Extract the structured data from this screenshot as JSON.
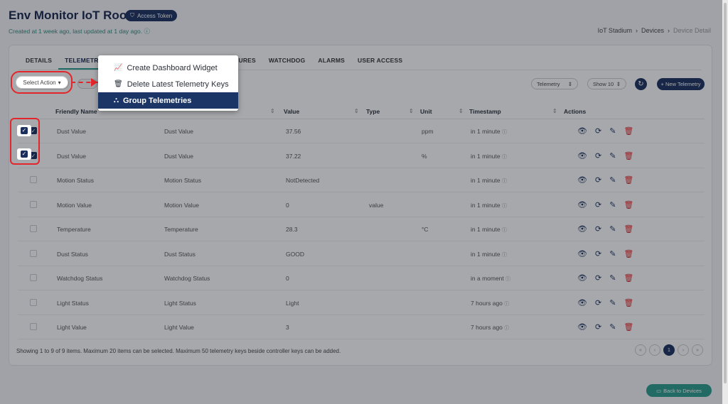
{
  "header": {
    "title": "Env Monitor IoT Room",
    "token_badge": "Access Token",
    "meta": "Created at 1 week ago, last updated at 1 day ago.",
    "breadcrumb": [
      "IoT Stadium",
      "Devices",
      "Device Detail"
    ]
  },
  "tabs": [
    "DETAILS",
    "TELEMETRY",
    "TURES",
    "WATCHDOG",
    "ALARMS",
    "USER ACCESS"
  ],
  "active_tab": "TELEMETRY",
  "toolbar": {
    "select_action": "Select Action",
    "telemetry_filter": "Telemetry",
    "show_count": "Show 10",
    "new_button": "+ New Telemetry"
  },
  "dropdown": {
    "items": [
      {
        "icon": "chart-line-icon",
        "label": "Create Dashboard Widget"
      },
      {
        "icon": "trash-icon",
        "label": "Delete Latest Telemetry Keys"
      },
      {
        "icon": "hierarchy-icon",
        "label": "Group Telemetries"
      }
    ],
    "selected": "Group Telemetries"
  },
  "table": {
    "columns": [
      "Friendly Name",
      "Name",
      "Value",
      "Type",
      "Unit",
      "Timestamp",
      "Actions"
    ],
    "rows": [
      {
        "checked": true,
        "friendly": "Dust Value",
        "name": "Dust Value",
        "value": "37.56",
        "type": "",
        "unit": "ppm",
        "ts": "in 1 minute"
      },
      {
        "checked": true,
        "friendly": "Dust Value",
        "name": "Dust Value",
        "value": "37.22",
        "type": "",
        "unit": "%",
        "ts": "in 1 minute"
      },
      {
        "checked": false,
        "friendly": "Motion Status",
        "name": "Motion Status",
        "value": "NotDetected",
        "type": "",
        "unit": "",
        "ts": "in 1 minute"
      },
      {
        "checked": false,
        "friendly": "Motion Value",
        "name": "Motion Value",
        "value": "0",
        "type": "value",
        "unit": "",
        "ts": "in 1 minute"
      },
      {
        "checked": false,
        "friendly": "Temperature",
        "name": "Temperature",
        "value": "28.3",
        "type": "",
        "unit": "°C",
        "ts": "in 1 minute"
      },
      {
        "checked": false,
        "friendly": "Dust Status",
        "name": "Dust Status",
        "value": "GOOD",
        "type": "",
        "unit": "",
        "ts": "in 1 minute"
      },
      {
        "checked": false,
        "friendly": "Watchdog Status",
        "name": "Watchdog Status",
        "value": "0",
        "type": "",
        "unit": "",
        "ts": "in a moment"
      },
      {
        "checked": false,
        "friendly": "Light Status",
        "name": "Light Status",
        "value": "Light",
        "type": "",
        "unit": "",
        "ts": "7 hours ago"
      },
      {
        "checked": false,
        "friendly": "Light Value",
        "name": "Light Value",
        "value": "3",
        "type": "",
        "unit": "",
        "ts": "7 hours ago"
      }
    ]
  },
  "footer": {
    "summary": "Showing 1 to 9 of 9 items. Maximum 20 items can be selected. Maximum 50 telemetry keys beside controller keys can be added.",
    "current_page": "1"
  },
  "back_button": "Back to Devices",
  "colors": {
    "navy": "#1b2f5e",
    "teal": "#2a9d8f",
    "highlight": "#e3262b"
  }
}
